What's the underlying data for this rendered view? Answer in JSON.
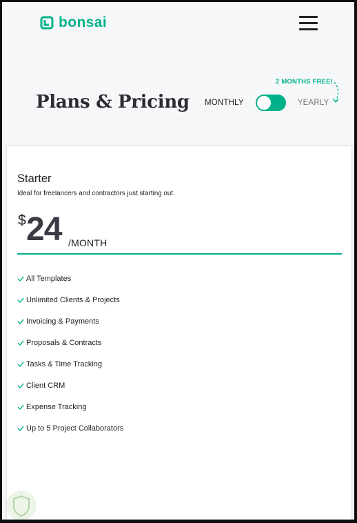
{
  "header": {
    "logo_text": "bonsai",
    "menu_icon": "hamburger-menu-icon"
  },
  "pricing": {
    "title": "Plans & Pricing",
    "promo": "2 MONTHS FREE!",
    "toggle": {
      "monthly_label": "MONTHLY",
      "yearly_label": "YEARLY",
      "selected": "MONTHLY"
    }
  },
  "plan": {
    "name": "Starter",
    "description": "Ideal for freelancers and contractors just starting out.",
    "currency": "$",
    "amount": "24",
    "period": "/MONTH",
    "features": [
      "All Templates",
      "Unlimited Clients & Projects",
      "Invoicing & Payments",
      "Proposals & Contracts",
      "Tasks & Time Tracking",
      "Client CRM",
      "Expense Tracking",
      "Up to 5 Project Collaborators"
    ]
  },
  "colors": {
    "brand": "#00b289",
    "text": "#222222",
    "background": "#f6f7f9"
  }
}
